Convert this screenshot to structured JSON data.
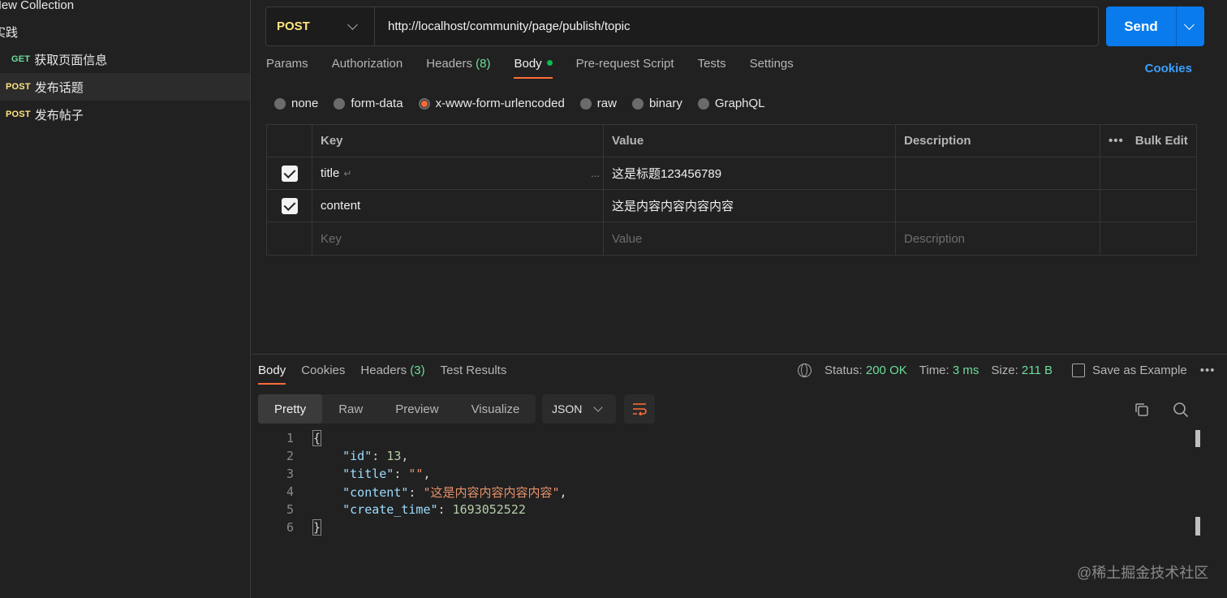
{
  "sidebar": {
    "collection_name": "New Collection",
    "folder_name": "实践",
    "requests": [
      {
        "method": "GET",
        "name": "获取页面信息"
      },
      {
        "method": "POST",
        "name": "发布话题"
      },
      {
        "method": "POST",
        "name": "发布帖子"
      }
    ]
  },
  "request": {
    "method": "POST",
    "url": "http://localhost/community/page/publish/topic",
    "send_label": "Send"
  },
  "tabs": {
    "params": "Params",
    "authorization": "Authorization",
    "headers": "Headers",
    "headers_count": "(8)",
    "body": "Body",
    "prerequest": "Pre-request Script",
    "tests": "Tests",
    "settings": "Settings",
    "cookies": "Cookies"
  },
  "body_types": {
    "none": "none",
    "form_data": "form-data",
    "urlencoded": "x-www-form-urlencoded",
    "raw": "raw",
    "binary": "binary",
    "graphql": "GraphQL",
    "selected": "x-www-form-urlencoded"
  },
  "params_table": {
    "headers": {
      "key": "Key",
      "value": "Value",
      "description": "Description",
      "bulk_edit": "Bulk Edit"
    },
    "rows": [
      {
        "checked": true,
        "key": "title",
        "value": "这是标题123456789",
        "description": ""
      },
      {
        "checked": true,
        "key": "content",
        "value": "这是内容内容内容内容",
        "description": ""
      }
    ],
    "placeholders": {
      "key": "Key",
      "value": "Value",
      "description": "Description"
    }
  },
  "response": {
    "tabs": {
      "body": "Body",
      "cookies": "Cookies",
      "headers": "Headers",
      "headers_count": "(3)",
      "test_results": "Test Results"
    },
    "status_label": "Status:",
    "status_value": "200 OK",
    "time_label": "Time:",
    "time_value": "3 ms",
    "size_label": "Size:",
    "size_value": "211 B",
    "save_example": "Save as Example",
    "views": {
      "pretty": "Pretty",
      "raw": "Raw",
      "preview": "Preview",
      "visualize": "Visualize"
    },
    "format": "JSON",
    "code": {
      "id_key": "\"id\"",
      "id_val": "13",
      "title_key": "\"title\"",
      "title_val": "\"\"",
      "content_key": "\"content\"",
      "content_val": "\"这是内容内容内容内容\"",
      "create_time_key": "\"create_time\"",
      "create_time_val": "1693052522"
    }
  },
  "watermark": "@稀土掘金技术社区",
  "colors": {
    "accent": "#ff6c37",
    "send": "#097bed",
    "post": "#ffe47e",
    "get": "#6bdd9a",
    "success": "#6bdd9a"
  }
}
